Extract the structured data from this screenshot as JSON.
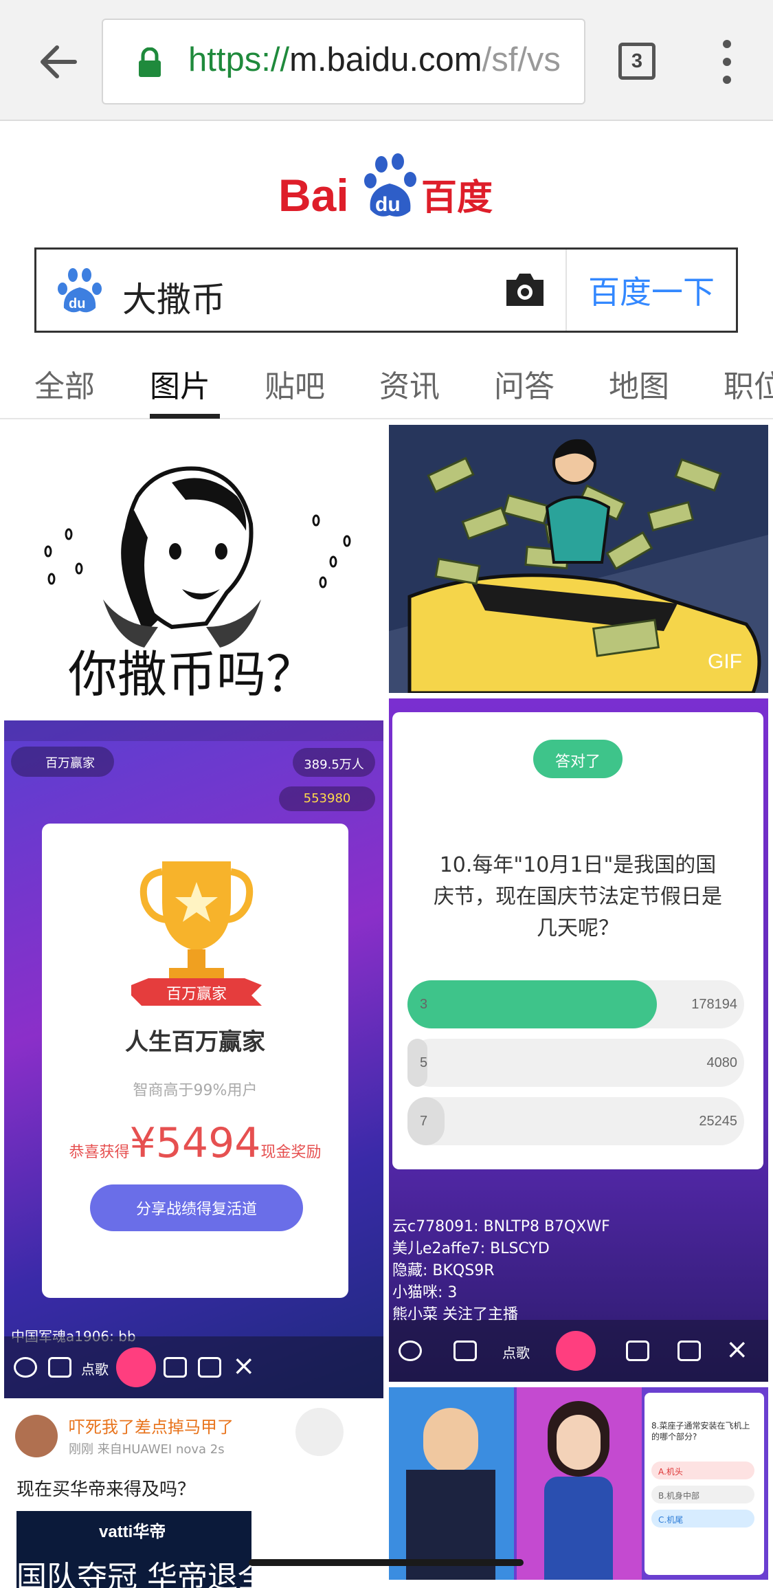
{
  "browser": {
    "url_protocol": "https://",
    "url_host": "m.baidu.com",
    "url_path": "/sf/vs",
    "tab_count": "3",
    "icons": [
      "back-arrow-icon",
      "lock-icon",
      "more-vertical-icon"
    ]
  },
  "logo": {
    "text": "Bai du 百度"
  },
  "search": {
    "query": "大撒币",
    "button_label": "百度一下",
    "icons": [
      "baidu-paw-icon",
      "camera-icon"
    ]
  },
  "tabs": [
    {
      "label": "全部"
    },
    {
      "label": "图片"
    },
    {
      "label": "贴吧"
    },
    {
      "label": "资讯"
    },
    {
      "label": "问答"
    },
    {
      "label": "地图"
    },
    {
      "label": "职位"
    }
  ],
  "active_tab": "图片",
  "results": {
    "tile1": {
      "caption": "你撒币吗？"
    },
    "tile2": {
      "badge": "GIF"
    },
    "tile3": {
      "card_title": "人生百万赢家",
      "card_sub": "智商高于99%用户",
      "prize_prefix": "恭喜获得",
      "prize_amount": "¥5494",
      "prize_suffix": "现金奖励",
      "share_button": "分享战绩得复活道",
      "ribbon": "百万赢家",
      "viewers": "389.5万人",
      "coins": "553980",
      "chat_line": "中国军魂a1906: bb",
      "bottom_label": "点歌"
    },
    "tile4": {
      "question": "10.每年\"10月1日\"是我国的国庆节，现在国庆节法定节假日是几天呢？",
      "answered_badge": "答对了",
      "options": [
        {
          "label": "3",
          "count": "178194",
          "share": 0.74
        },
        {
          "label": "5",
          "count": "4080",
          "share": 0.02
        },
        {
          "label": "7",
          "count": "25245",
          "share": 0.11
        }
      ],
      "chat": [
        "云c778091: BNLTP8 B7QXWF",
        "美儿e2affe7: BLSCYD",
        "隐藏: BKQS9R",
        "小猫咪: 3",
        "熊小菜 关注了主播"
      ],
      "bottom_label": "点歌"
    },
    "tile5": {
      "title": "吓死我了差点掉马甲了",
      "meta": "刚刚  来自HUAWEI nova 2s",
      "text": "现在买华帝来得及吗？",
      "ad_text": "vatti华帝",
      "big_text": "国队夺冠 华帝退全"
    },
    "tile6": {
      "question": "8.菜座子通常安装在飞机上的哪个部分?",
      "options": [
        "A.机头",
        "B.机身中部",
        "C.机尾"
      ]
    }
  }
}
